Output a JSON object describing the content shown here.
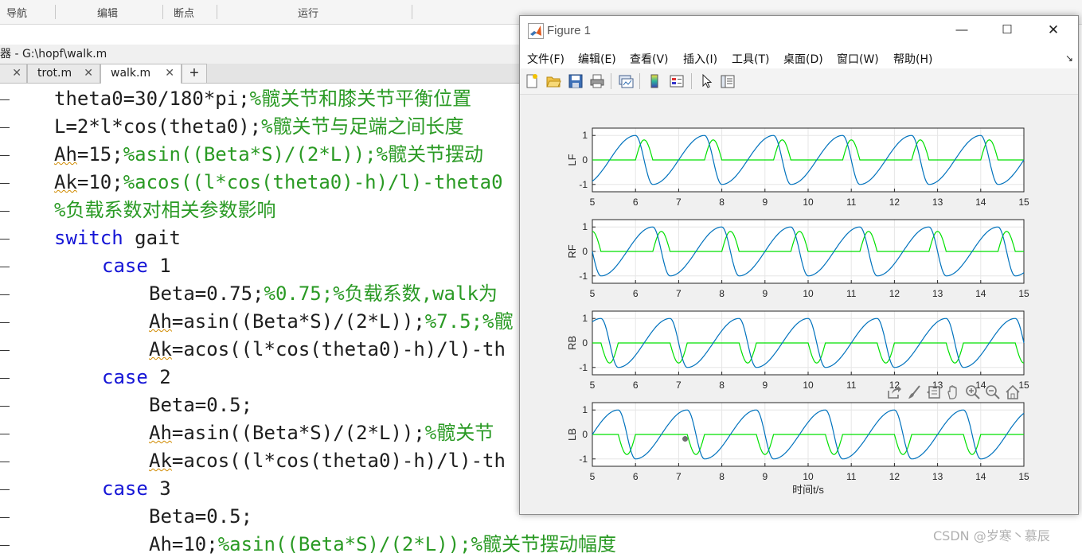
{
  "toolstrip": {
    "sections": [
      {
        "label": "导航"
      },
      {
        "label": "编辑"
      },
      {
        "label": "断点"
      },
      {
        "label": "运行"
      }
    ]
  },
  "editor": {
    "title": "器 - G:\\hopf\\walk.m",
    "tabs": [
      {
        "label": "trot.m",
        "active": false
      },
      {
        "label": "walk.m",
        "active": true
      }
    ],
    "add_tab_label": "+",
    "lines": [
      {
        "indent": 1,
        "parts": [
          {
            "t": "theta0=30/180*pi;",
            "c": "plain"
          },
          {
            "t": "%髋关节和膝关节平衡位置",
            "c": "cm"
          }
        ]
      },
      {
        "indent": 1,
        "parts": [
          {
            "t": "L=2*l*cos(theta0);",
            "c": "plain"
          },
          {
            "t": "%髋关节与足端之间长度",
            "c": "cm"
          }
        ]
      },
      {
        "indent": 1,
        "parts": [
          {
            "t": "Ah",
            "c": "warn"
          },
          {
            "t": "=15;",
            "c": "plain"
          },
          {
            "t": "%asin((Beta*S)/(2*L));%髋关节摆动",
            "c": "cm"
          }
        ]
      },
      {
        "indent": 1,
        "parts": [
          {
            "t": "Ak",
            "c": "warn"
          },
          {
            "t": "=10;",
            "c": "plain"
          },
          {
            "t": "%acos((l*cos(theta0)-h)/l)-theta0",
            "c": "cm"
          }
        ]
      },
      {
        "indent": 1,
        "parts": [
          {
            "t": "%负载系数对相关参数影响",
            "c": "cm"
          }
        ]
      },
      {
        "indent": 1,
        "parts": [
          {
            "t": "switch",
            "c": "kw"
          },
          {
            "t": " gait",
            "c": "plain"
          }
        ]
      },
      {
        "indent": 2,
        "parts": [
          {
            "t": "case",
            "c": "kw"
          },
          {
            "t": " 1",
            "c": "plain"
          }
        ]
      },
      {
        "indent": 3,
        "parts": [
          {
            "t": "Beta=0.75;",
            "c": "plain"
          },
          {
            "t": "%0.75;%负载系数,walk为",
            "c": "cm"
          }
        ]
      },
      {
        "indent": 3,
        "parts": [
          {
            "t": "Ah",
            "c": "warn"
          },
          {
            "t": "=asin((Beta*S)/(2*L));",
            "c": "plain"
          },
          {
            "t": "%7.5;%髋",
            "c": "cm"
          }
        ]
      },
      {
        "indent": 3,
        "parts": [
          {
            "t": "Ak",
            "c": "warn"
          },
          {
            "t": "=acos((l*cos(theta0)-h)/l)-th",
            "c": "plain"
          }
        ]
      },
      {
        "indent": 2,
        "parts": [
          {
            "t": "case",
            "c": "kw"
          },
          {
            "t": " 2",
            "c": "plain"
          }
        ]
      },
      {
        "indent": 3,
        "parts": [
          {
            "t": "Beta=0.5;",
            "c": "plain"
          }
        ]
      },
      {
        "indent": 3,
        "parts": [
          {
            "t": "Ah",
            "c": "warn"
          },
          {
            "t": "=asin((Beta*S)/(2*L));",
            "c": "plain"
          },
          {
            "t": "%髋关节",
            "c": "cm"
          }
        ]
      },
      {
        "indent": 3,
        "parts": [
          {
            "t": "Ak",
            "c": "warn"
          },
          {
            "t": "=acos((l*cos(theta0)-h)/l)-th",
            "c": "plain"
          }
        ]
      },
      {
        "indent": 2,
        "parts": [
          {
            "t": "case",
            "c": "kw"
          },
          {
            "t": " 3",
            "c": "plain"
          }
        ]
      },
      {
        "indent": 3,
        "parts": [
          {
            "t": "Beta=0.5;",
            "c": "plain"
          }
        ]
      },
      {
        "indent": 3,
        "parts": [
          {
            "t": "Ah=10;",
            "c": "plain"
          },
          {
            "t": "%asin((Beta*S)/(2*L));%髋关节摆动幅度",
            "c": "cm"
          }
        ]
      }
    ]
  },
  "figure": {
    "title": "Figure 1",
    "menus": [
      "文件(F)",
      "编辑(E)",
      "查看(V)",
      "插入(I)",
      "工具(T)",
      "桌面(D)",
      "窗口(W)",
      "帮助(H)"
    ],
    "toolbar_icons": [
      "new-figure-icon",
      "open-file-icon",
      "save-icon",
      "print-icon",
      "link-plot-icon",
      "colorbar-icon",
      "legend-icon",
      "edit-plot-icon",
      "property-inspector-icon"
    ],
    "axes_toolbar_icons": [
      "export-icon",
      "brush-icon",
      "datatip-icon",
      "pan-icon",
      "zoom-in-icon",
      "zoom-out-icon",
      "restore-view-icon"
    ]
  },
  "chart_data": {
    "type": "line",
    "xlabel": "时间t/s",
    "xlim": [
      5,
      15
    ],
    "xticks": [
      5,
      6,
      7,
      8,
      9,
      10,
      11,
      12,
      13,
      14,
      15
    ],
    "ylim": [
      -1.3,
      1.3
    ],
    "yticks": [
      -1,
      0,
      1
    ],
    "grid": true,
    "colors": {
      "hip": "#0072bd",
      "knee": "#00e000"
    },
    "period": 1.6,
    "subplots": [
      {
        "ylabel": "LF",
        "hip_phase": 0.0,
        "knee_phase": 0.0,
        "knee_sign": 1
      },
      {
        "ylabel": "RF",
        "hip_phase": 0.4,
        "knee_phase": 0.4,
        "knee_sign": 1
      },
      {
        "ylabel": "RB",
        "hip_phase": 0.8,
        "knee_phase": 0.8,
        "knee_sign": -1
      },
      {
        "ylabel": "LB",
        "hip_phase": 1.2,
        "knee_phase": 1.2,
        "knee_sign": -1
      }
    ],
    "datatip": {
      "x": 7.15,
      "y": -0.18
    }
  },
  "watermark": "CSDN @岁寒丶慕辰"
}
